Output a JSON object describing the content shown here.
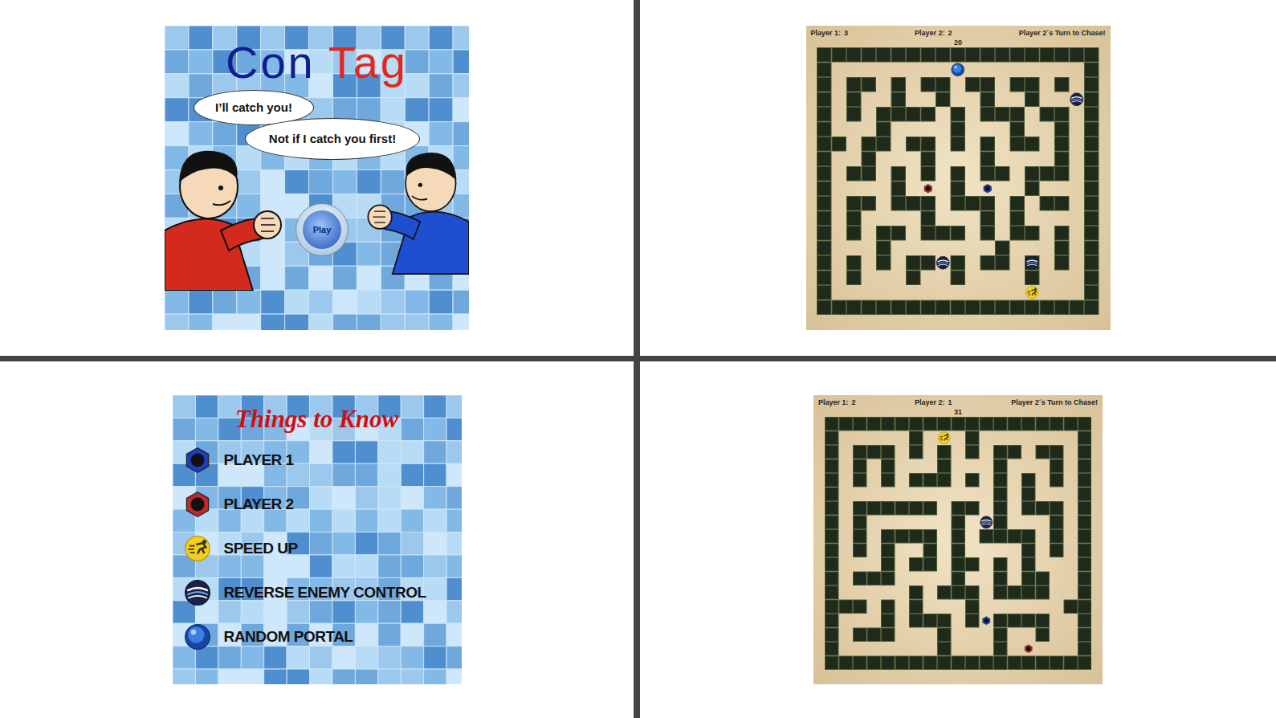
{
  "title_screen": {
    "title": [
      {
        "text": "Con",
        "color": "#0f1f8f"
      },
      {
        "text": "Tag",
        "color": "#e3261f"
      }
    ],
    "bubbles": [
      "I’ll catch you!",
      "Not if I catch you first!"
    ],
    "characters": [
      {
        "color": "#d42a1e"
      },
      {
        "color": "#1f4fd0"
      }
    ],
    "play_button": "Play"
  },
  "game_1": {
    "scores": [
      {
        "label": "Player 1:",
        "value": "3"
      },
      {
        "label": "Player 2:",
        "value": "2"
      }
    ],
    "status": "Player 2´s Turn to Chase!",
    "timer": "20",
    "maze": [
      "###################",
      "#.................#",
      "#.##.#.##.##.##.#.#",
      "#.#..#..#..#..#...#",
      "#.#.####.#.###.##.#",
      "#...#....#...#..#.#",
      "##.##.##.#.#.##.#.#",
      "#..#...#...#....#.#",
      "#.##.#.#.#.##.###.#",
      "#....#...#....#...#",
      "#.##.###.###.#.##.#",
      "#.#....#...#.#....#",
      "#.#.##.###.#.##.#.#",
      "#...#.......#...#.#",
      "#.#.#.##.#.##.#.#.#",
      "#.#...#..#....#...#",
      "#.................#",
      "###################"
    ],
    "items": [
      {
        "kind": "portal",
        "row": 1,
        "col": 9
      },
      {
        "kind": "reverse",
        "row": 3,
        "col": 17
      },
      {
        "kind": "player2",
        "row": 9,
        "col": 7
      },
      {
        "kind": "player1",
        "row": 9,
        "col": 11
      },
      {
        "kind": "reverse",
        "row": 14,
        "col": 8
      },
      {
        "kind": "reverse",
        "row": 14,
        "col": 14
      },
      {
        "kind": "speed",
        "row": 16,
        "col": 14
      }
    ]
  },
  "legend": {
    "title": "Things to Know",
    "items": [
      {
        "kind": "player1",
        "label": "PLAYER 1"
      },
      {
        "kind": "player2",
        "label": "PLAYER 2"
      },
      {
        "kind": "speed",
        "label": "SPEED UP"
      },
      {
        "kind": "reverse",
        "label": "REVERSE ENEMY CONTROL"
      },
      {
        "kind": "portal",
        "label": "RANDOM PORTAL"
      }
    ]
  },
  "game_2": {
    "scores": [
      {
        "label": "Player 1:",
        "value": "2"
      },
      {
        "label": "Player 2:",
        "value": "1"
      }
    ],
    "status": "Player 2´s Turn to Chase!",
    "timer": "31",
    "maze": [
      "###################",
      "#.....#...#.......#",
      "#.###.#.#.#.##.##.#",
      "#.#.#...#...#...#.#",
      "#.#.#.###.#.#.#.#.#",
      "#...........#.#...#",
      "#.######.##.#.###.#",
      "#.#......#..#...#.#",
      "#.#.####.#.####.#.#",
      "#.#.#..#.#....#.#.#",
      "#...#.##.##.#.#...#",
      "#.###....#..#.##..#",
      "#.....#.###.####..#",
      "###.#.#...#......##",
      "#...#.###.#.####..#",
      "#.###...#...#..#..#",
      "#.......#...#.....#",
      "###################"
    ],
    "items": [
      {
        "kind": "speed",
        "row": 1,
        "col": 8
      },
      {
        "kind": "reverse",
        "row": 7,
        "col": 11
      },
      {
        "kind": "player1",
        "row": 14,
        "col": 11
      },
      {
        "kind": "player2",
        "row": 16,
        "col": 14
      }
    ]
  }
}
